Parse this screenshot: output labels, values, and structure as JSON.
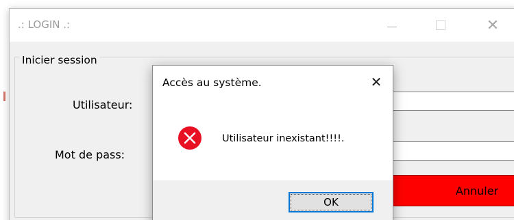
{
  "login_window": {
    "title": ".: LOGIN .:",
    "controls": {
      "minimize_icon": "minimize-icon",
      "maximize_icon": "maximize-icon",
      "close_glyph": "✕"
    },
    "group_title": "Inicier session",
    "user_label": "Utilisateur:",
    "user_value": "",
    "pass_label": "Mot de pass:",
    "pass_value": "",
    "cancel_button": "Annuler",
    "cancel_color": "#ff0000"
  },
  "message_box": {
    "title": "Accès au système.",
    "close_glyph": "✕",
    "icon": "error-icon",
    "icon_color": "#e81123",
    "message": "Utilisateur inexistant!!!!.",
    "ok_button": "OK",
    "focus_color": "#0078d7"
  }
}
